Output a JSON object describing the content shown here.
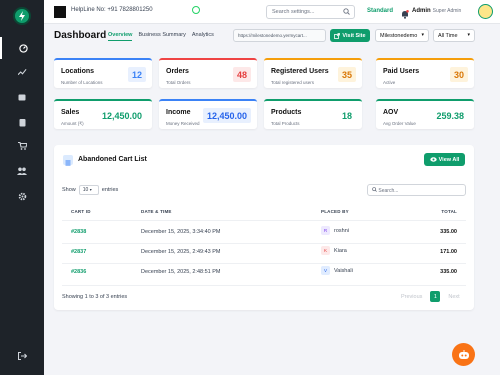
{
  "topbar": {
    "helpline": "HelpLine No: +91 7828801250",
    "search_placeholder": "Search settings...",
    "plan": "Standard",
    "admin_name": "Admin",
    "admin_role": "Super Admin"
  },
  "page": {
    "title": "Dashboard",
    "tabs": [
      "Overview",
      "Business Summary",
      "Analytics"
    ],
    "site_url": "https://milestonedemo.yermycart...",
    "visit_label": "Visit Site",
    "store_select": "Milestonedemo",
    "range_select": "All Time"
  },
  "cards": [
    {
      "title": "Locations",
      "sub": "Number of Locations",
      "value": "12",
      "accent": "#3b82f6",
      "bg": "#e8f0fe",
      "fg": "#3b82f6"
    },
    {
      "title": "Orders",
      "sub": "Total Orders",
      "value": "48",
      "accent": "#ef4444",
      "bg": "#fde8e8",
      "fg": "#e53e3e"
    },
    {
      "title": "Registered Users",
      "sub": "Total registered users",
      "value": "35",
      "accent": "#f59e0b",
      "bg": "#fef3dc",
      "fg": "#d97706"
    },
    {
      "title": "Paid Users",
      "sub": "Active",
      "value": "30",
      "accent": "#f59e0b",
      "bg": "#fef3dc",
      "fg": "#d97706"
    },
    {
      "title": "Sales",
      "sub": "Amount (₹)",
      "value": "12,450.00",
      "accent": "#0f9d6c",
      "bg": "#ffffff",
      "fg": "#0f9d6c"
    },
    {
      "title": "Income",
      "sub": "Money Received",
      "value": "12,450.00",
      "accent": "#3b82f6",
      "bg": "#e8f0fe",
      "fg": "#2563eb"
    },
    {
      "title": "Products",
      "sub": "Total Products",
      "value": "18",
      "accent": "#0f9d6c",
      "bg": "#ffffff",
      "fg": "#0f9d6c"
    },
    {
      "title": "AOV",
      "sub": "Avg Order Value",
      "value": "259.38",
      "accent": "#0f9d6c",
      "bg": "#ffffff",
      "fg": "#0f9d6c"
    }
  ],
  "cart": {
    "title": "Abandoned Cart List",
    "view_all": "View All",
    "show_label": "Show",
    "show_value": "10",
    "entries_label": "entries",
    "search_placeholder": "Search...",
    "headers": [
      "CART ID",
      "DATE & TIME",
      "PLACED BY",
      "TOTAL"
    ],
    "rows": [
      {
        "id": "#2838",
        "date": "December 15, 2025, 3:34:40 PM",
        "initial": "R",
        "name": "roshni",
        "total": "335.00",
        "ibg": "#ede9fe",
        "ifg": "#7c3aed"
      },
      {
        "id": "#2837",
        "date": "December 15, 2025, 2:49:43 PM",
        "initial": "K",
        "name": "Kiara",
        "total": "171.00",
        "ibg": "#fde8e8",
        "ifg": "#e53e3e"
      },
      {
        "id": "#2836",
        "date": "December 15, 2025, 2:48:51 PM",
        "initial": "V",
        "name": "Vaishali",
        "total": "335.00",
        "ibg": "#e0ecff",
        "ifg": "#2563eb"
      }
    ],
    "info": "Showing 1 to 3 of 3 entries",
    "prev": "Previous",
    "page": "1",
    "next": "Next"
  }
}
